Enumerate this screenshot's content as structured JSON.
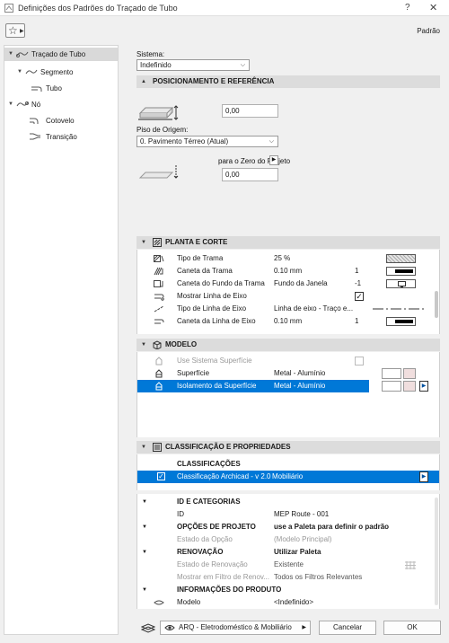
{
  "window": {
    "title": "Definições dos Padrões do Traçado de Tubo",
    "help": "?",
    "close": "✕"
  },
  "toolbar": {
    "favorites_icon": "star-icon",
    "preset_label": "Padrão"
  },
  "tree": {
    "items": [
      {
        "label": "Traçado de Tubo",
        "arrow": "▼"
      },
      {
        "label": "Segmento",
        "arrow": "▼"
      },
      {
        "label": "Tubo",
        "arrow": ""
      },
      {
        "label": "Nó",
        "arrow": "▼"
      },
      {
        "label": "Cotovelo",
        "arrow": ""
      },
      {
        "label": "Transição",
        "arrow": ""
      }
    ]
  },
  "system": {
    "label": "Sistema:",
    "value": "Indefinido"
  },
  "sections": {
    "positioning": "POSICIONAMENTO E REFERÊNCIA",
    "plan": "PLANTA E CORTE",
    "model": "MODELO",
    "classification": "CLASSIFICAÇÃO E PROPRIEDADES"
  },
  "positioning": {
    "offset_value": "0,00",
    "origin_label": "Piso de Origem:",
    "origin_value": "0. Pavimento Térreo (Atual)",
    "zero_label": "para o Zero do Projeto",
    "zero_value": "0,00"
  },
  "plan": {
    "rows": [
      {
        "name": "Tipo de Trama",
        "value": "25 %",
        "aux": ""
      },
      {
        "name": "Caneta da Trama",
        "value": "0.10 mm",
        "aux": "1"
      },
      {
        "name": "Caneta do Fundo da Trama",
        "value": "Fundo da Janela",
        "aux": "-1"
      },
      {
        "name": "Mostrar Linha de Eixo",
        "value": "",
        "aux": ""
      },
      {
        "name": "Tipo de Linha de Eixo",
        "value": "Linha de eixo - Traço e...",
        "aux": ""
      },
      {
        "name": "Caneta da Linha de Eixo",
        "value": "0.10 mm",
        "aux": "1"
      }
    ]
  },
  "model": {
    "rows": [
      {
        "name": "Use Sistema Superfície",
        "value": ""
      },
      {
        "name": "Superfície",
        "value": "Metal - Alumínio"
      },
      {
        "name": "Isolamento da Superfície",
        "value": "Metal - Alumínio"
      }
    ]
  },
  "classification": {
    "header": "CLASSIFICAÇÕES",
    "row": {
      "name": "Classificação Archicad - v 2.0",
      "value": "Mobiliário"
    }
  },
  "properties": {
    "rows": [
      {
        "name": "ID E CATEGORIAS",
        "value": "",
        "kind": "group"
      },
      {
        "name": "ID",
        "value": "MEP Route - 001",
        "kind": "item"
      },
      {
        "name": "OPÇÕES DE PROJETO",
        "value": "use a Paleta para definir o padrão",
        "kind": "group"
      },
      {
        "name": "Estado da Opção",
        "value": "(Modelo Principal)",
        "kind": "dis"
      },
      {
        "name": "RENOVAÇÃO",
        "value": "Utilizar Paleta",
        "kind": "group"
      },
      {
        "name": "Estado de Renovação",
        "value": "Existente",
        "kind": "dis"
      },
      {
        "name": "Mostrar em Filtro de Renov...",
        "value": "Todos os Filtros Relevantes",
        "kind": "dis"
      },
      {
        "name": "INFORMAÇÕES DO PRODUTO",
        "value": "",
        "kind": "group"
      },
      {
        "name": "Modelo",
        "value": "<Indefinido>",
        "kind": "item"
      }
    ]
  },
  "footer": {
    "layer": "ARQ - Eletrodoméstico & Mobiliário",
    "cancel": "Cancelar",
    "ok": "OK"
  },
  "colors": {
    "selection": "#0078d7",
    "section_header": "#dcdcdc"
  }
}
